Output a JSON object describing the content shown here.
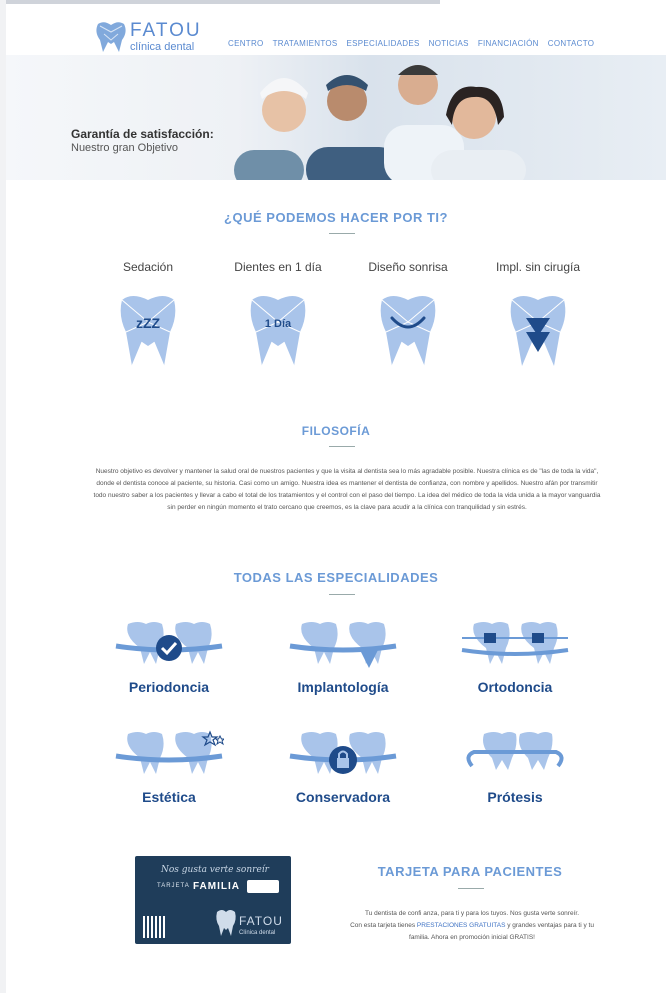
{
  "brand": {
    "name": "FATOU",
    "subtitle": "clínica dental",
    "accent_color": "#6b9ad6",
    "dark_color": "#1f4b8a"
  },
  "nav": {
    "items": [
      "CENTRO",
      "TRATAMIENTOS",
      "ESPECIALIDADES",
      "NOTICIAS",
      "FINANCIACIÓN",
      "CONTACTO"
    ]
  },
  "hero": {
    "title": "Garantía de satisfacción:",
    "subtitle": "Nuestro gran Objetivo"
  },
  "services": {
    "title": "¿QUÉ PODEMOS HACER POR TI?",
    "items": [
      {
        "label": "Sedación",
        "icon_text": "zZZ",
        "icon": "tooth-sleep-icon"
      },
      {
        "label": "Dientes en 1 día",
        "icon_text": "1 Día",
        "icon": "tooth-one-day-icon"
      },
      {
        "label": "Diseño sonrisa",
        "icon_text": "",
        "icon": "tooth-smile-icon"
      },
      {
        "label": "Impl. sin cirugía",
        "icon_text": "",
        "icon": "tooth-arrow-down-icon"
      }
    ]
  },
  "philosophy": {
    "title": "FILOSOFÍA",
    "text": "Nuestro objetivo es devolver y mantener la salud oral de nuestros pacientes y que la visita al dentista sea lo más agradable posible. Nuestra clínica es de \"las de toda la vida\", donde el dentista conoce al paciente, su historia. Casi como un amigo. Nuestra idea es mantener el dentista de confianza, con nombre y apellidos. Nuestro afán por transmitir todo nuestro saber a los pacientes y llevar a cabo el total de los tratamientos y el control con el paso del tiempo. La idea del médico de toda la vida unida a la mayor vanguardia sin perder en ningún momento el trato cercano que creemos, es la clave para acudir a la clínica con tranquilidad y sin estrés."
  },
  "specialties": {
    "title": "TODAS LAS ESPECIALIDADES",
    "items": [
      {
        "label": "Periodoncia",
        "icon": "teeth-check-icon"
      },
      {
        "label": "Implantología",
        "icon": "teeth-implant-icon"
      },
      {
        "label": "Ortodoncia",
        "icon": "teeth-braces-icon"
      },
      {
        "label": "Estética",
        "icon": "teeth-stars-icon"
      },
      {
        "label": "Conservadora",
        "icon": "teeth-lock-icon"
      },
      {
        "label": "Prótesis",
        "icon": "teeth-prosthesis-icon"
      }
    ]
  },
  "card": {
    "script": "Nos gusta verte sonreír",
    "tarjeta": "TARJETA",
    "familia": "FAMILIA",
    "logo_name": "FATOU",
    "logo_sub": "Clínica dental"
  },
  "patient_card": {
    "title": "TARJETA PARA PACIENTES",
    "line1": "Tu dentista de confi  anza, para ti y para los tuyos. Nos gusta verte sonreír.",
    "line2_pre": "Con esta tarjeta tienes ",
    "line2_highlight": "PRESTACIONES GRATUITAS",
    "line2_post": " y grandes ventajas para ti y tu familia. Ahora en promoción inicial GRATIS!"
  }
}
